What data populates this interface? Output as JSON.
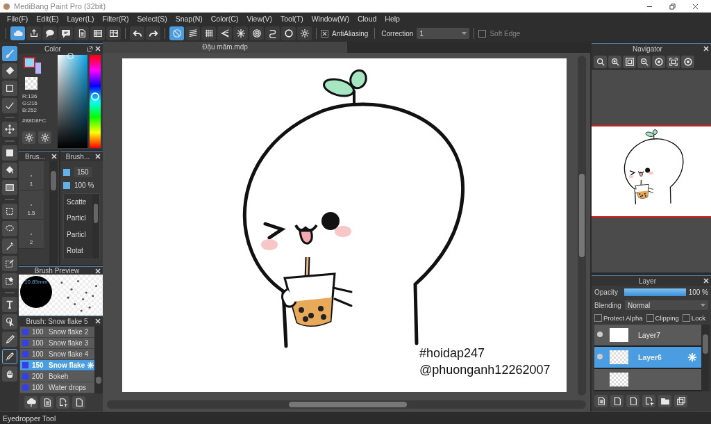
{
  "window": {
    "title": "MediBang Paint Pro (32bit)"
  },
  "menu": [
    "File(F)",
    "Edit(E)",
    "Layer(L)",
    "Filter(R)",
    "Select(S)",
    "Snap(N)",
    "Color(C)",
    "View(V)",
    "Tool(T)",
    "Window(W)",
    "Cloud",
    "Help"
  ],
  "toolbar": {
    "groups": [
      {
        "buttons": [
          {
            "selected": true
          },
          {
            "selected": false
          },
          {
            "selected": false
          },
          {
            "selected": false
          },
          {
            "selected": false
          },
          {
            "selected": false
          },
          {
            "selected": false
          }
        ]
      },
      {
        "buttons": [
          {
            "selected": false
          },
          {
            "selected": false
          }
        ]
      },
      {
        "buttons": [
          {
            "selected": true
          },
          {
            "selected": false
          },
          {
            "selected": false
          },
          {
            "selected": false
          },
          {
            "selected": false
          },
          {
            "selected": false
          },
          {
            "selected": false
          },
          {
            "selected": false
          },
          {
            "selected": false
          }
        ]
      }
    ],
    "antialiasing": {
      "label": "AntiAliasing",
      "checked": true
    },
    "correction": {
      "label": "Correction",
      "value": "1"
    },
    "soft_edge": {
      "label": "Soft Edge",
      "checked": false
    }
  },
  "tools": [
    [
      {
        "selected": true,
        "focused": false
      },
      {
        "selected": false,
        "focused": false
      },
      {
        "selected": false,
        "focused": false
      },
      {
        "selected": false,
        "focused": false
      }
    ],
    [
      {
        "selected": false,
        "focused": false
      }
    ],
    [
      {
        "selected": false,
        "focused": false
      },
      {
        "selected": false,
        "focused": false
      },
      {
        "selected": false,
        "focused": false
      }
    ],
    [
      {
        "selected": false,
        "focused": false
      },
      {
        "selected": false,
        "focused": false
      },
      {
        "selected": false,
        "focused": false
      },
      {
        "selected": false,
        "focused": false
      },
      {
        "selected": false,
        "focused": false
      }
    ],
    [
      {
        "selected": false,
        "focused": false
      },
      {
        "selected": false,
        "focused": false
      },
      {
        "selected": false,
        "focused": false
      },
      {
        "selected": false,
        "focused": true
      },
      {
        "selected": false,
        "focused": false
      }
    ]
  ],
  "color_panel": {
    "title": "Color",
    "r": "R:136",
    "g": "G:216",
    "b": "B:252",
    "hex": "#88D8FC",
    "hue": {
      "level": 0.56
    }
  },
  "brush_size_panel": {
    "title": "Brus...",
    "sizes": [
      {
        "label": "1"
      },
      {
        "label": "1.5"
      },
      {
        "label": "2"
      }
    ]
  },
  "brush_settings_panel": {
    "title": "Brush...",
    "size": "150",
    "opacity": "100 %",
    "params": [
      "Scatte",
      "Particl",
      "Particl",
      "Rotat"
    ]
  },
  "brush_preview": {
    "title": "Brush Preview",
    "size": "10.89mm"
  },
  "brush_list": {
    "title": "Brush: Snow flake 5",
    "items": [
      {
        "size": "100",
        "name": "Snow flake 2",
        "selected": false
      },
      {
        "size": "100",
        "name": "Snow flake 3",
        "selected": false
      },
      {
        "size": "100",
        "name": "Snow flake 4",
        "selected": false
      },
      {
        "size": "150",
        "name": "Snow flake",
        "selected": true
      },
      {
        "size": "200",
        "name": "Bokeh",
        "selected": false
      },
      {
        "size": "100",
        "name": "Water drops",
        "selected": false
      }
    ]
  },
  "document": {
    "tab": "Đậu mãm.mdp",
    "canvas_texts": [
      "#hoidap247",
      "@phuonganh12262007"
    ]
  },
  "navigator": {
    "title": "Navigator"
  },
  "layer_panel": {
    "title": "Layer",
    "opacity_label": "Opacity",
    "opacity": {
      "level": 1.0
    },
    "opacity_value": "100 %",
    "blending_label": "Blending",
    "blending": "Normal",
    "options": [
      {
        "label": "Protect Alpha",
        "checked": false
      },
      {
        "label": "Clipping",
        "checked": false
      },
      {
        "label": "Lock",
        "checked": false
      }
    ],
    "layers": [
      {
        "name": "Layer7",
        "selected": false,
        "visible": true
      },
      {
        "name": "Layer6",
        "selected": true,
        "visible": true
      },
      {
        "selected": false,
        "visible": false
      }
    ]
  },
  "status_bar": "Eyedropper Tool"
}
